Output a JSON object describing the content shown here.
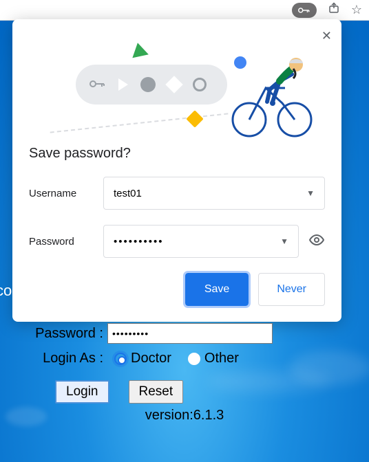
{
  "browser": {
    "icons": {
      "key": "⚿",
      "share": "⇪",
      "star": "☆"
    }
  },
  "popup": {
    "title": "Save password?",
    "username_label": "Username",
    "username_value": "test01",
    "password_label": "Password",
    "password_value": "••••••••••",
    "save_label": "Save",
    "never_label": "Never"
  },
  "login": {
    "co_fragment": "co",
    "password_label": "Password  :",
    "password_value": "•••••••••",
    "login_as_label": "Login As  :",
    "role_options": [
      "Doctor",
      "Other"
    ],
    "role_selected": "Doctor",
    "login_btn": "Login",
    "reset_btn": "Reset",
    "version": "version:6.1.3"
  }
}
